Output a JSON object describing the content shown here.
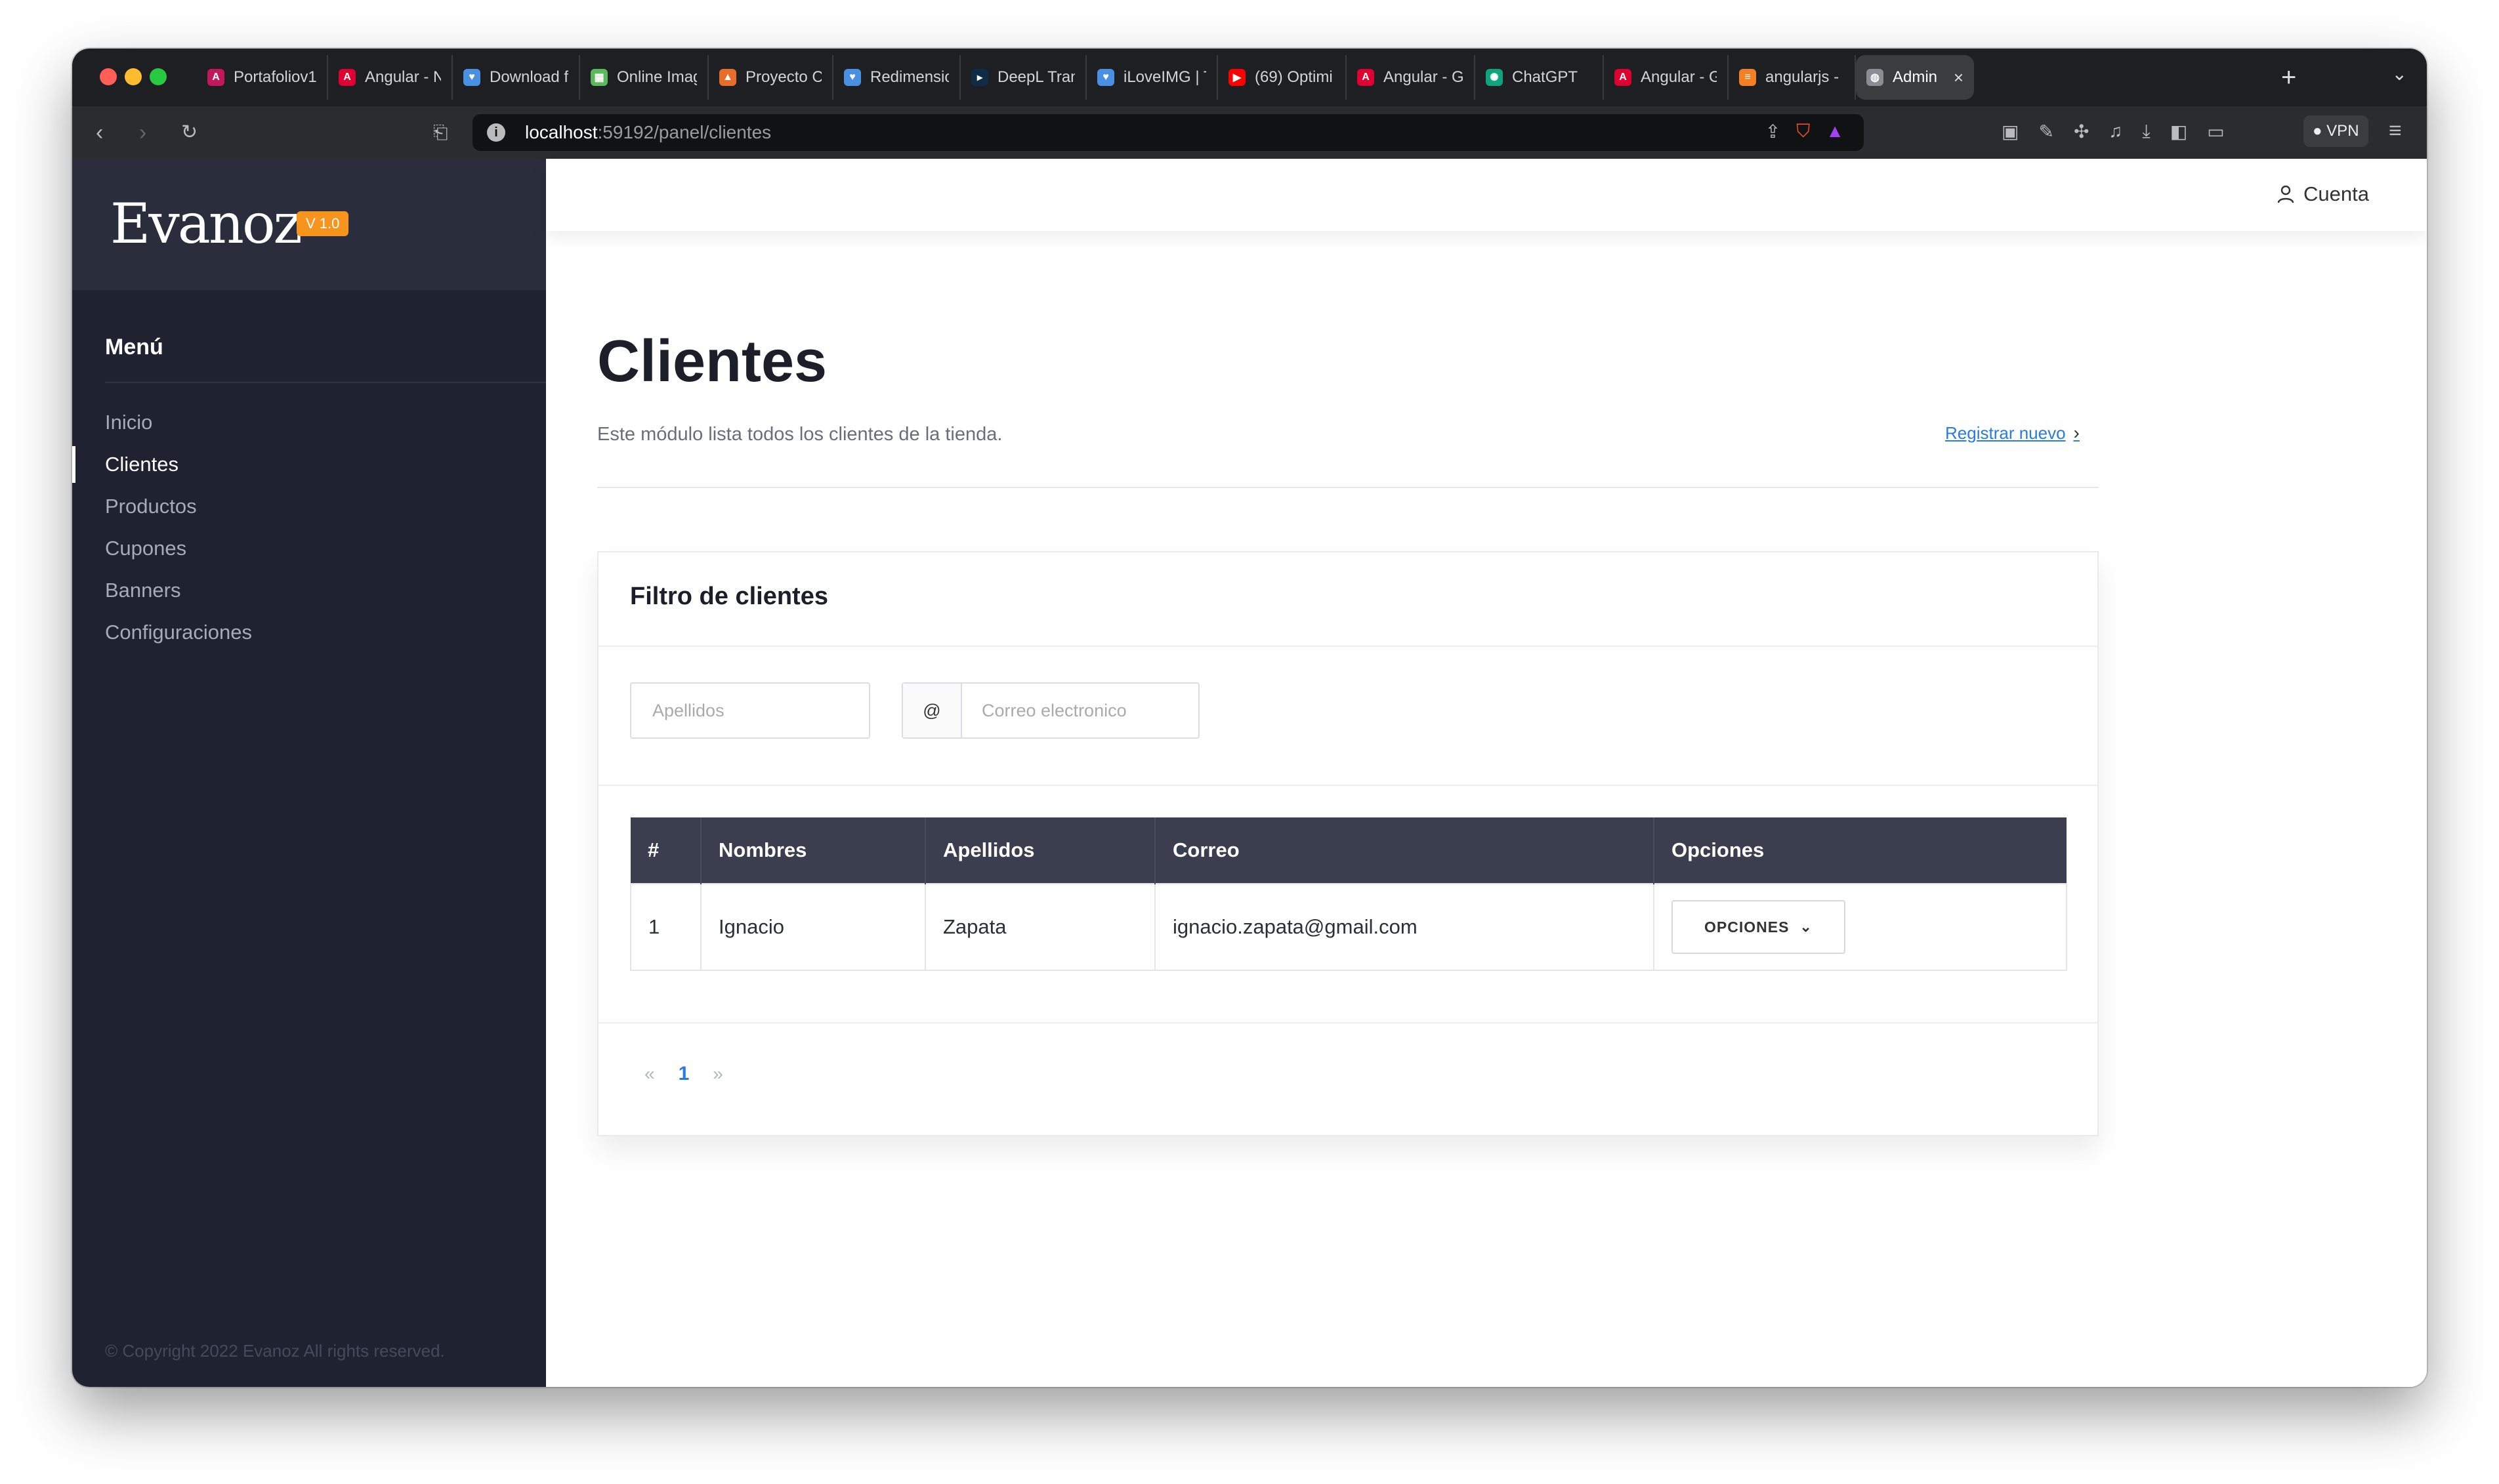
{
  "browser": {
    "tabs": [
      {
        "title": "Portafoliov1",
        "color": "#c2185b",
        "icon": "angular-icon"
      },
      {
        "title": "Angular - N",
        "color": "#dd0031",
        "icon": "angular-icon"
      },
      {
        "title": "Download fi",
        "color": "#4a90e2",
        "icon": "heart-icon"
      },
      {
        "title": "Online Imag",
        "color": "#5cb85c",
        "icon": "grid-icon"
      },
      {
        "title": "Proyecto Ca",
        "color": "#e86c2c",
        "icon": "triangle-icon"
      },
      {
        "title": "Redimensio",
        "color": "#4a90e2",
        "icon": "heart-icon"
      },
      {
        "title": "DeepL Tran",
        "color": "#0f2b46",
        "icon": "deepl-icon"
      },
      {
        "title": "iLoveIMG | T",
        "color": "#4a90e2",
        "icon": "heart-icon"
      },
      {
        "title": "(69) Optimi",
        "color": "#ff0000",
        "icon": "youtube-icon"
      },
      {
        "title": "Angular - G",
        "color": "#dd0031",
        "icon": "angular-icon"
      },
      {
        "title": "ChatGPT",
        "color": "#10a37f",
        "icon": "chatgpt-icon"
      },
      {
        "title": "Angular - G",
        "color": "#dd0031",
        "icon": "angular-icon"
      },
      {
        "title": "angularjs - ",
        "color": "#f48024",
        "icon": "stackoverflow-icon"
      },
      {
        "title": "Admin",
        "color": "#8a8d94",
        "icon": "globe-icon",
        "active": true
      }
    ],
    "new_tab": "+",
    "url_host": "localhost",
    "url_path": ":59192/panel/clientes",
    "vpn_label": "VPN"
  },
  "sidebar": {
    "logo": "Evanoz",
    "version": "V 1.0",
    "menu_title": "Menú",
    "items": [
      {
        "label": "Inicio"
      },
      {
        "label": "Clientes",
        "active": true
      },
      {
        "label": "Productos"
      },
      {
        "label": "Cupones"
      },
      {
        "label": "Banners"
      },
      {
        "label": "Configuraciones"
      }
    ],
    "copyright": "© Copyright 2022 Evanoz All rights reserved."
  },
  "header": {
    "account_label": "Cuenta"
  },
  "page": {
    "title": "Clientes",
    "subtitle": "Este módulo lista todos los clientes de la tienda.",
    "register_link": "Registrar nuevo"
  },
  "filter": {
    "title": "Filtro de clientes",
    "apellidos_placeholder": "Apellidos",
    "email_addon": "@",
    "email_placeholder": "Correo electronico"
  },
  "table": {
    "headers": [
      "#",
      "Nombres",
      "Apellidos",
      "Correo",
      "Opciones"
    ],
    "rows": [
      {
        "num": "1",
        "nombres": "Ignacio",
        "apellidos": "Zapata",
        "correo": "ignacio.zapata@gmail.com",
        "opciones": "OPCIONES"
      }
    ]
  },
  "pagination": {
    "prev": "«",
    "current": "1",
    "next": "»"
  }
}
